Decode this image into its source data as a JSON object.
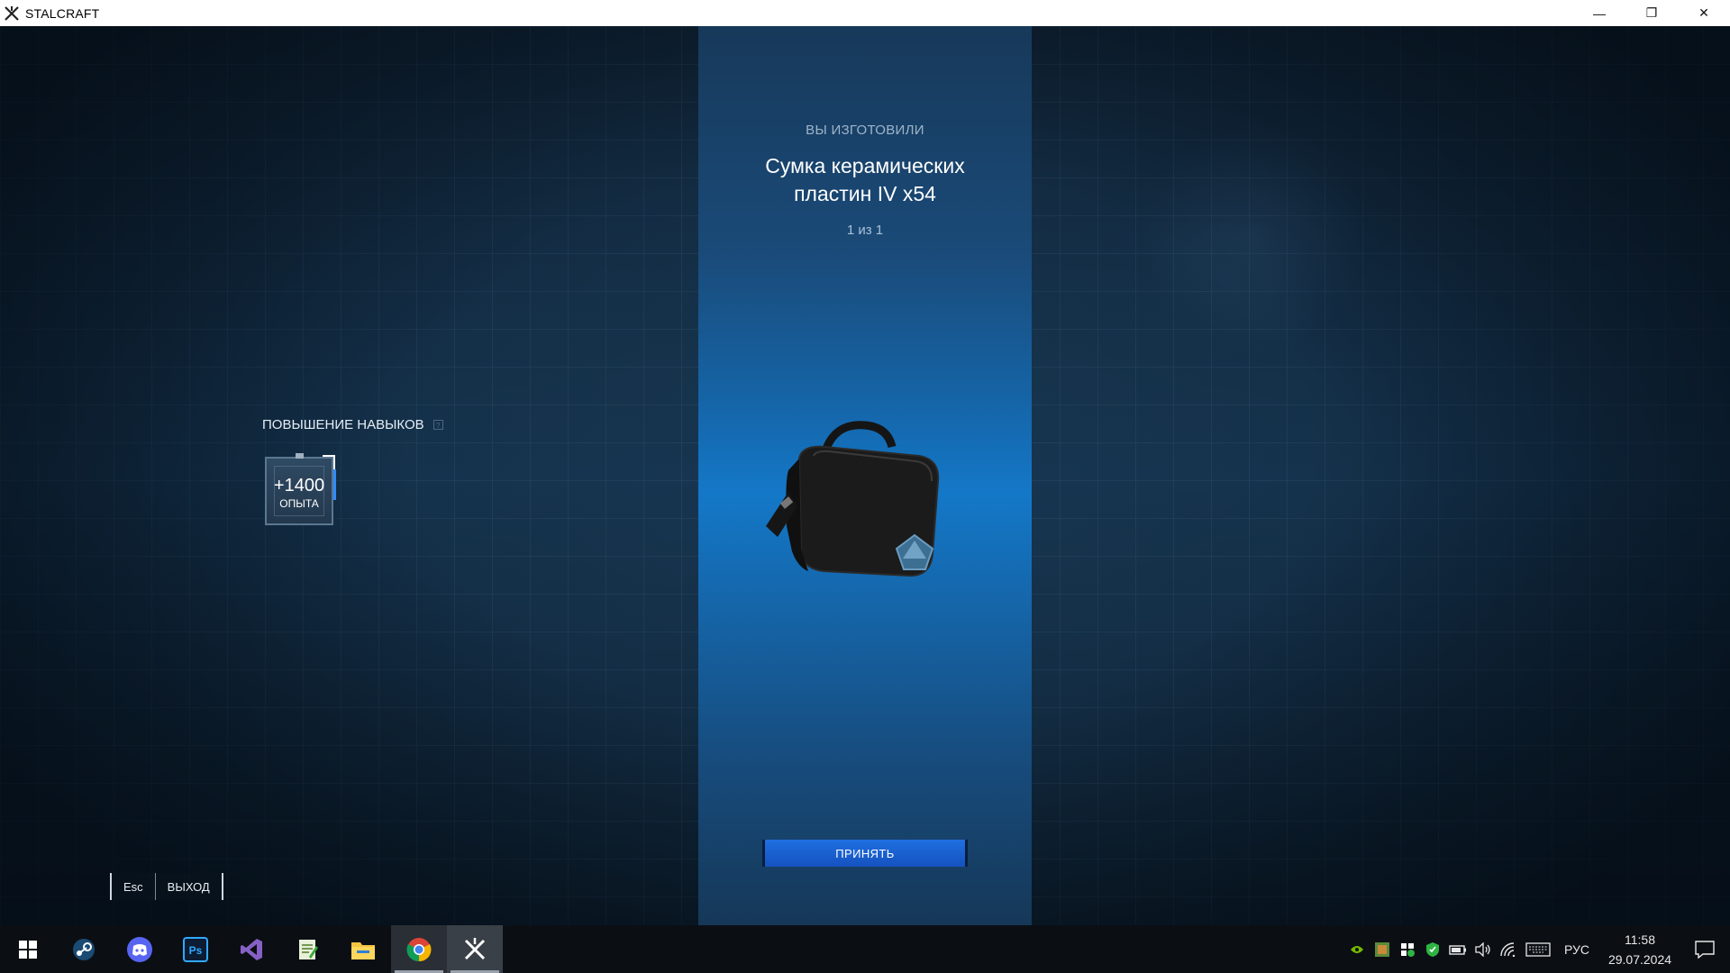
{
  "window": {
    "title": "STALCRAFT",
    "minimize": "—",
    "restore": "❐",
    "close": "✕"
  },
  "craft_result": {
    "heading": "ВЫ ИЗГОТОВИЛИ",
    "item_name_line1": "Сумка керамических",
    "item_name_line2": "пластин IV x54",
    "counter": "1 из 1",
    "item_image": "black-bag-with-blue-pentagon-badge",
    "accept_label": "ПРИНЯТЬ"
  },
  "skills": {
    "title": "ПОВЫШЕНИЕ НАВЫКОВ",
    "help": "?",
    "xp_amount": "+1400",
    "xp_unit": "ОПЫТА"
  },
  "exit": {
    "key": "Esc",
    "label": "ВЫХОД"
  },
  "taskbar": {
    "apps": [
      "windows-start-icon",
      "steam-icon",
      "discord-icon",
      "photoshop-icon",
      "visual-studio-icon",
      "notepad-icon",
      "file-explorer-icon",
      "chrome-icon",
      "stalcraft-icon"
    ],
    "photoshop_text": "Ps",
    "language": "РУС",
    "time": "11:58",
    "date": "29.07.2024"
  },
  "colors": {
    "accent_blue": "#1f6fe0",
    "column_center": "#1478c8",
    "background": "#0d1e2e"
  }
}
